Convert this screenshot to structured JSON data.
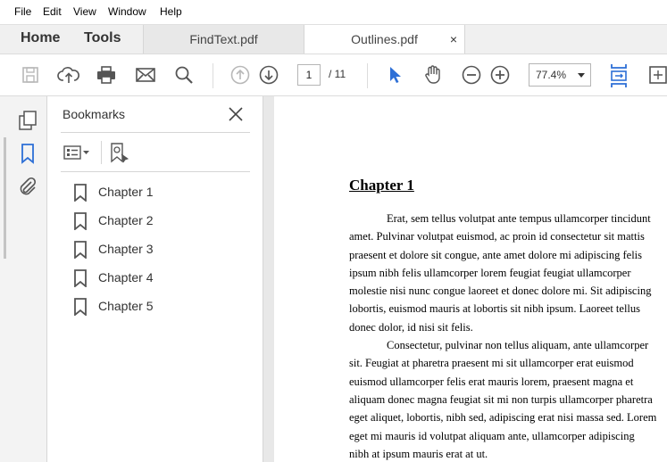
{
  "menu": [
    "File",
    "Edit",
    "View",
    "Window",
    "Help"
  ],
  "tabs": {
    "home": "Home",
    "tools": "Tools",
    "documents": [
      {
        "label": "FindText.pdf",
        "active": false
      },
      {
        "label": "Outlines.pdf",
        "active": true,
        "close": "×"
      }
    ]
  },
  "toolbar": {
    "page_current": "1",
    "page_total": "/ 11",
    "zoom": "77.4%",
    "icons": [
      "save-icon",
      "upload-icon",
      "print-icon",
      "email-icon",
      "search-icon",
      "prev-page-icon",
      "next-page-icon",
      "select-cursor-icon",
      "hand-tool-icon",
      "zoom-out-icon",
      "zoom-in-icon",
      "fit-width-icon",
      "fit-page-icon"
    ],
    "accent": "#2d6fd6"
  },
  "bookmarks_panel": {
    "title": "Bookmarks",
    "items": [
      {
        "label": "Chapter 1"
      },
      {
        "label": "Chapter 2"
      },
      {
        "label": "Chapter 3"
      },
      {
        "label": "Chapter 4"
      },
      {
        "label": "Chapter 5"
      }
    ]
  },
  "document": {
    "heading": "Chapter 1",
    "lines": [
      "Erat, sem tellus volutpat ante tempus ullamcorper tincidunt",
      "amet. Pulvinar volutpat euismod, ac proin id consectetur sit mattis",
      "praesent et dolore sit congue, ante amet dolore mi adipiscing felis",
      "ipsum nibh felis ullamcorper lorem feugiat feugiat ullamcorper",
      "molestie nisi nunc congue laoreet et donec dolore mi. Sit adipiscing",
      "lobortis, euismod mauris at lobortis sit nibh ipsum. Laoreet tellus",
      "donec dolor, id nisi sit felis.",
      "Consectetur, pulvinar non tellus aliquam, ante ullamcorper",
      "sit. Feugiat at pharetra praesent mi sit ullamcorper erat euismod",
      "euismod ullamcorper felis erat mauris lorem, praesent magna et",
      "aliquam donec magna feugiat sit mi non turpis ullamcorper pharetra",
      "eget aliquet, lobortis, nibh sed, adipiscing erat nisi massa sed. Lorem",
      "eget mi mauris id volutpat aliquam ante, ullamcorper adipiscing",
      "nibh at ipsum mauris erat at ut."
    ]
  }
}
